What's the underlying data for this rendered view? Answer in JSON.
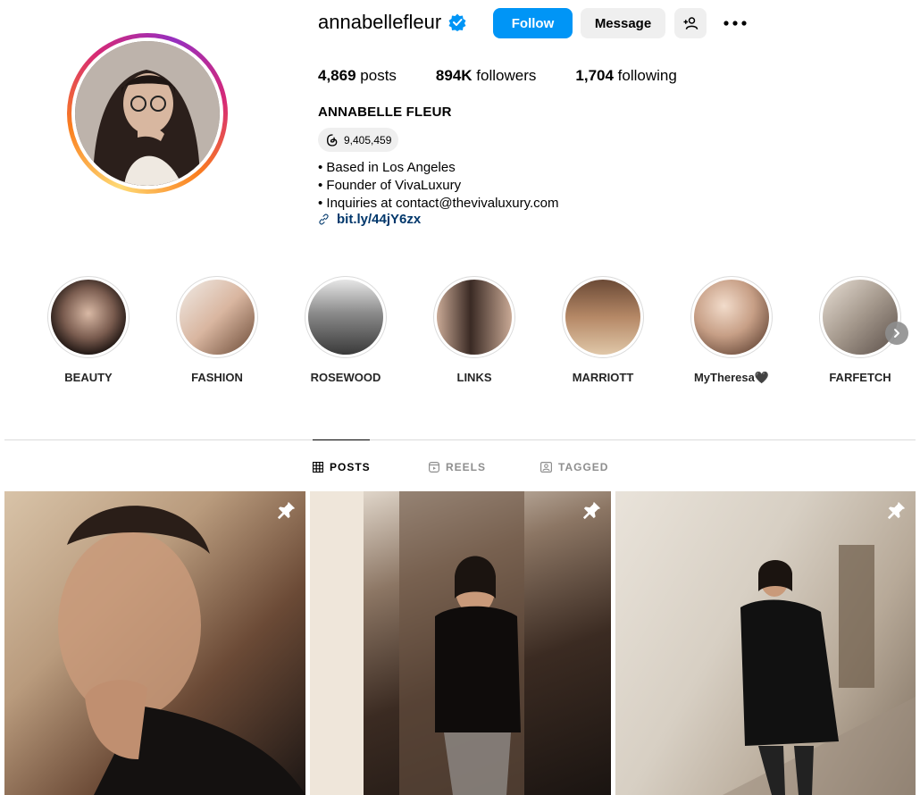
{
  "profile": {
    "username": "annabellefleur",
    "full_name": "ANNABELLE FLEUR",
    "threads_count": "9,405,459",
    "bio_lines": [
      "• Based in Los Angeles",
      "• Founder of VivaLuxury",
      "• Inquiries at contact@thevivaluxury.com"
    ],
    "link": "bit.ly/44jY6zx"
  },
  "actions": {
    "follow": "Follow",
    "message": "Message"
  },
  "stats": {
    "posts_value": "4,869",
    "posts_label": "posts",
    "followers_value": "894K",
    "followers_label": "followers",
    "following_value": "1,704",
    "following_label": "following"
  },
  "highlights": [
    {
      "label": "BEAUTY"
    },
    {
      "label": "FASHION"
    },
    {
      "label": "ROSEWOOD"
    },
    {
      "label": "LINKS"
    },
    {
      "label": "MARRIOTT"
    },
    {
      "label": "MyTheresa🖤"
    },
    {
      "label": "FARFETCH"
    }
  ],
  "tabs": {
    "posts": "POSTS",
    "reels": "REELS",
    "tagged": "TAGGED"
  },
  "colors": {
    "accent": "#0095f6",
    "link": "#00376b",
    "verified": "#0095f6"
  }
}
